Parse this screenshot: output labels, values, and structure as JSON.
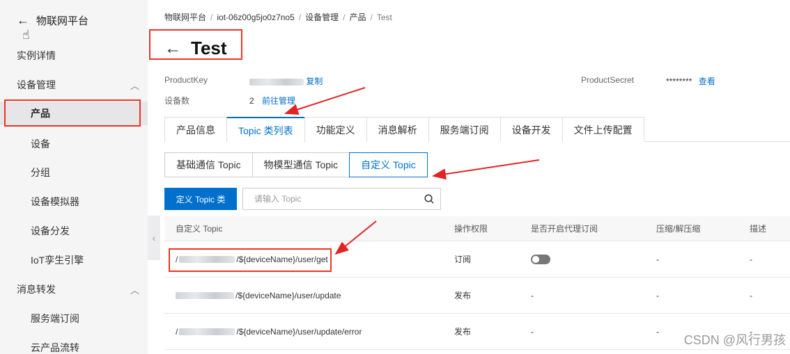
{
  "sidebar": {
    "back_label": "物联网平台",
    "items": [
      {
        "label": "实例详情"
      },
      {
        "label": "设备管理"
      },
      {
        "label": "产品"
      },
      {
        "label": "设备"
      },
      {
        "label": "分组"
      },
      {
        "label": "设备模拟器"
      },
      {
        "label": "设备分发"
      },
      {
        "label": "IoT孪生引擎"
      },
      {
        "label": "消息转发"
      },
      {
        "label": "服务端订阅"
      },
      {
        "label": "云产品流转"
      }
    ]
  },
  "breadcrumb": [
    "物联网平台",
    "iot-06z00g5jo0z7no5",
    "设备管理",
    "产品",
    "Test"
  ],
  "page": {
    "title": "Test"
  },
  "info": {
    "product_key_label": "ProductKey",
    "copy_label": "复制",
    "product_secret_label": "ProductSecret",
    "product_secret_value": "********",
    "view_label": "查看",
    "device_count_label": "设备数",
    "device_count_value": "2",
    "manage_label": "前往管理"
  },
  "tabs": [
    "产品信息",
    "Topic 类列表",
    "功能定义",
    "消息解析",
    "服务端订阅",
    "设备开发",
    "文件上传配置"
  ],
  "subtabs": [
    "基础通信 Topic",
    "物模型通信 Topic",
    "自定义 Topic"
  ],
  "toolbar": {
    "define_button": "定义 Topic 类",
    "search_placeholder": "请输入 Topic"
  },
  "table": {
    "headers": [
      "自定义 Topic",
      "操作权限",
      "是否开启代理订阅",
      "压缩/解压缩",
      "描述"
    ],
    "rows": [
      {
        "topic_prefix": "/",
        "topic_suffix": "/${deviceName}/user/get",
        "op": "订阅",
        "comp": "-",
        "desc": "-"
      },
      {
        "topic_prefix": "",
        "topic_suffix": "/${deviceName}/user/update",
        "op": "发布",
        "proxy": "-",
        "comp": "-",
        "desc": "-"
      },
      {
        "topic_prefix": "/",
        "topic_suffix": "/${deviceName}/user/update/error",
        "op": "发布",
        "proxy": "-",
        "comp": "-",
        "desc": "-"
      }
    ]
  },
  "watermark": "CSDN @风行男孩",
  "colors": {
    "accent": "#0070cc",
    "highlight": "#e32222"
  }
}
